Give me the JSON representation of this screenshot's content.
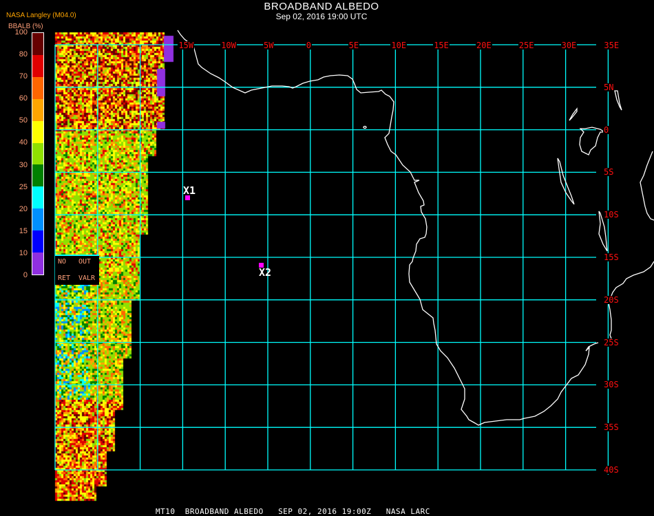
{
  "header": {
    "title": "BROADBAND ALBEDO",
    "subtitle": "Sep 02, 2016 19:00 UTC"
  },
  "legend": {
    "source": "NASA Langley (M04.0)",
    "variable": "BBALB (%)",
    "ticks": [
      "100",
      "80",
      "70",
      "60",
      "50",
      "40",
      "30",
      "25",
      "20",
      "15",
      "10",
      "0"
    ],
    "colors": [
      "#660000",
      "#e00000",
      "#ff6600",
      "#ffa500",
      "#ffff00",
      "#90e000",
      "#008000",
      "#00ffff",
      "#0090ff",
      "#0000ff",
      "#9030e0"
    ]
  },
  "grid": {
    "lon_labels": [
      "15W",
      "10W",
      "5W",
      "0",
      "5E",
      "10E",
      "15E",
      "20E",
      "25E",
      "30E",
      "35E"
    ],
    "lat_labels": [
      "5N",
      "0",
      "5S",
      "10S",
      "15S",
      "20S",
      "25S",
      "30S",
      "35S",
      "40S"
    ],
    "grid_color": "#00ffff",
    "label_color": "#ff1010",
    "coast_color": "#ffffff"
  },
  "markers": [
    {
      "label": "X1"
    },
    {
      "label": "X2"
    }
  ],
  "no_retrieval_box": {
    "no": "NO",
    "ret": "RET",
    "out": "OUT",
    "valr": "VALR"
  },
  "footer": {
    "text": "MT10  BROADBAND ALBEDO   SEP 02, 2016 19:00Z   NASA LARC"
  }
}
